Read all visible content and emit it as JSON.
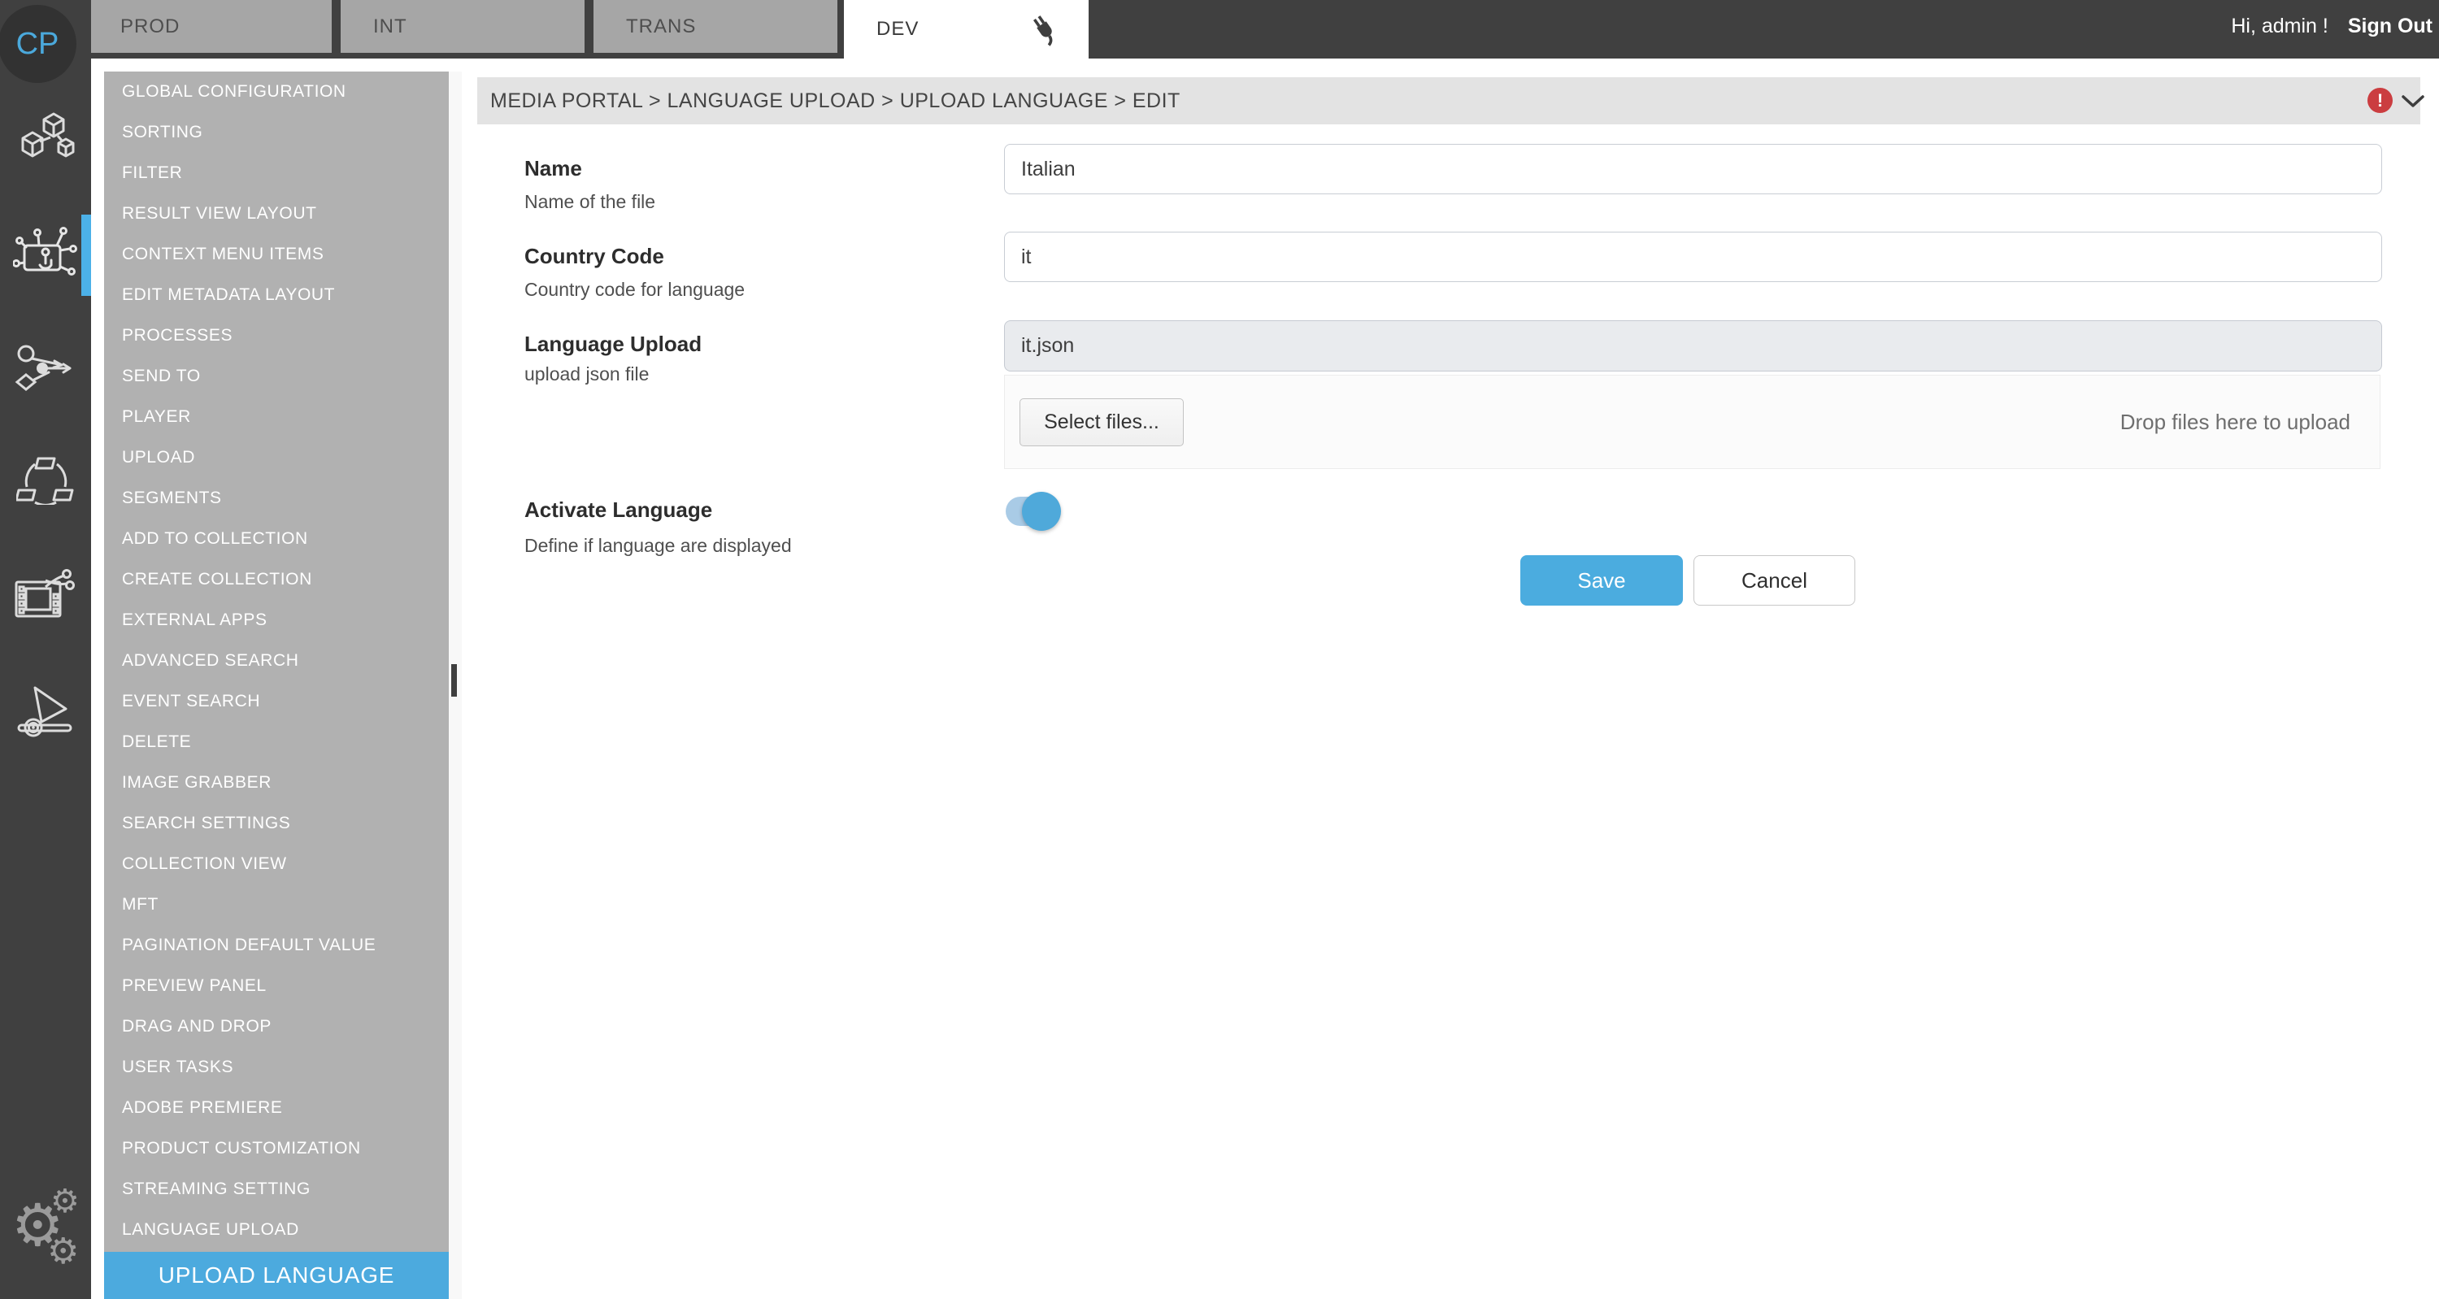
{
  "topbar": {
    "logo": "CP",
    "tabs": [
      "PROD",
      "INT",
      "TRANS"
    ],
    "active_tab": "DEV",
    "greeting": "Hi, admin !",
    "sign_out": "Sign Out"
  },
  "icon_rail": {
    "icons": [
      "cubes-network-icon",
      "touch-config-icon",
      "workflow-icon",
      "collection-cycle-icon",
      "video-edit-icon",
      "player-tools-icon",
      "settings-gears-icon"
    ],
    "active_icon": "touch-config-icon"
  },
  "sidebar": {
    "items": [
      "GLOBAL CONFIGURATION",
      "SORTING",
      "FILTER",
      "RESULT VIEW LAYOUT",
      "CONTEXT MENU ITEMS",
      "EDIT METADATA LAYOUT",
      "PROCESSES",
      "SEND TO",
      "PLAYER",
      "UPLOAD",
      "SEGMENTS",
      "ADD TO COLLECTION",
      "CREATE COLLECTION",
      "EXTERNAL APPS",
      "ADVANCED SEARCH",
      "EVENT SEARCH",
      "DELETE",
      "IMAGE GRABBER",
      "SEARCH SETTINGS",
      "COLLECTION VIEW",
      "MFT",
      "PAGINATION DEFAULT VALUE",
      "PREVIEW PANEL",
      "DRAG AND DROP",
      "USER TASKS",
      "ADOBE PREMIERE",
      "PRODUCT CUSTOMIZATION",
      "STREAMING SETTING",
      "LANGUAGE UPLOAD"
    ],
    "active_subitem": "UPLOAD LANGUAGE"
  },
  "breadcrumb": {
    "path": "MEDIA PORTAL > LANGUAGE UPLOAD > UPLOAD LANGUAGE > EDIT",
    "error_badge": "!"
  },
  "form": {
    "name": {
      "label": "Name",
      "help": "Name of the file",
      "value": "Italian"
    },
    "country_code": {
      "label": "Country Code",
      "help": "Country code for language",
      "value": "it"
    },
    "language_upload": {
      "label": "Language Upload",
      "help": "upload json file",
      "file_value": "it.json",
      "select_button": "Select files...",
      "drop_hint": "Drop files here to upload"
    },
    "activate_language": {
      "label": "Activate Language",
      "help": "Define if language are displayed",
      "state": "on"
    },
    "buttons": {
      "save": "Save",
      "cancel": "Cancel"
    }
  },
  "colors": {
    "topbar": "#404040",
    "sidebar_gray": "#b1b1b1",
    "tab_gray": "#a6a6a6",
    "accent_blue": "#4cb1e8",
    "active_item_blue": "#4caade",
    "save_blue": "#4bacdf",
    "toggle_track": "#a9cbe6",
    "toggle_knob": "#4fa9da",
    "error_red": "#cb3d40",
    "breadcrumb_gray": "#e3e3e3",
    "logo_blue": "#4ba9dc"
  }
}
